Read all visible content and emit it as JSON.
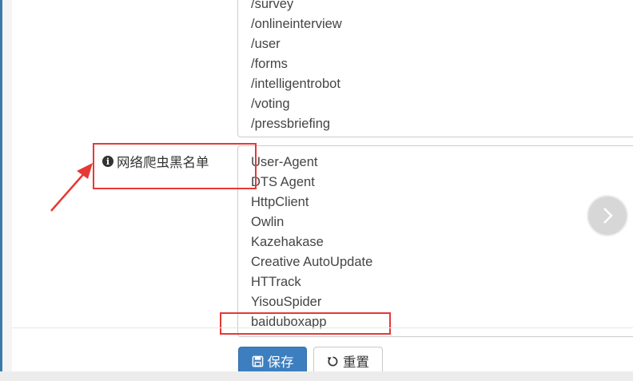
{
  "top_list": {
    "items": [
      "/survey",
      "/onlineinterview",
      "/user",
      "/forms",
      "/intelligentrobot",
      "/voting",
      "/pressbriefing"
    ]
  },
  "blacklist": {
    "label": "网络爬虫黑名单",
    "items": [
      "User-Agent",
      "DTS Agent",
      "HttpClient",
      "Owlin",
      "Kazehakase",
      "Creative AutoUpdate",
      "HTTrack",
      "YisouSpider",
      "baiduboxapp"
    ]
  },
  "buttons": {
    "save_label": "保存",
    "reset_label": "重置"
  },
  "icons": {
    "info": "info-icon",
    "save": "save-icon",
    "reset": "reset-icon",
    "next": "chevron-right-icon"
  },
  "colors": {
    "primary": "#3c7ebf",
    "annotation": "#e53935"
  }
}
